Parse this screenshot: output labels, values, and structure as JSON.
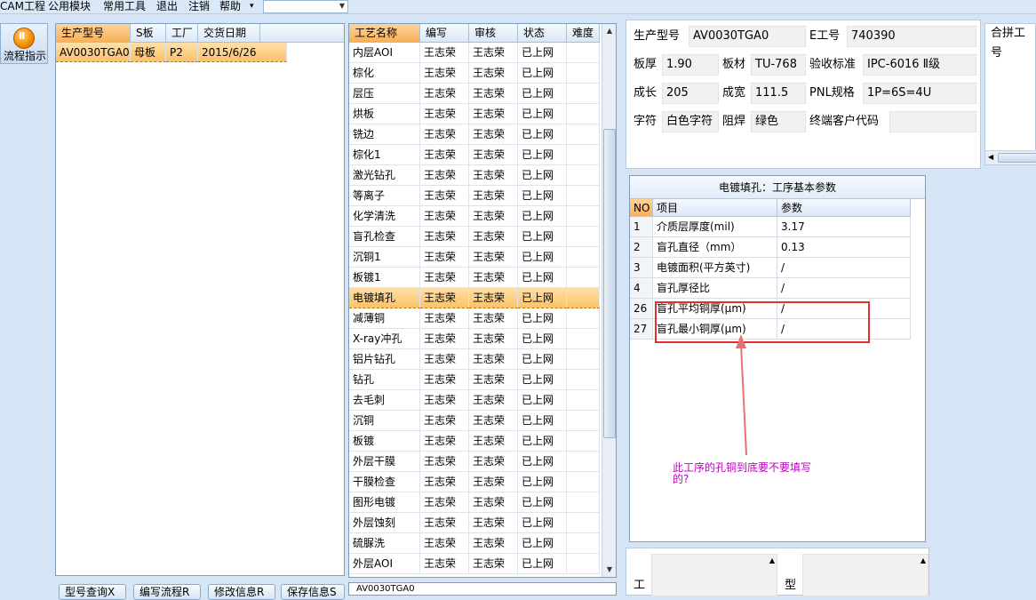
{
  "menu": {
    "items": [
      "CAM工程",
      "公用模块",
      "常用工具",
      "退出",
      "注销",
      "帮助"
    ],
    "help_arrow": "▾",
    "combo_value": ""
  },
  "toolbar": {
    "flow_label": "流程指示"
  },
  "orders": {
    "columns": [
      "生产型号",
      "S板",
      "工厂",
      "交货日期"
    ],
    "rows": [
      {
        "model": "AV0030TGA0",
        "board": "母板",
        "factory": "P2",
        "date": "2015/6/26"
      }
    ]
  },
  "processes": {
    "columns": [
      "工艺名称",
      "编写",
      "审核",
      "状态",
      "难度"
    ],
    "rows": [
      [
        "内层AOI",
        "王志荣",
        "王志荣",
        "已上网",
        ""
      ],
      [
        "棕化",
        "王志荣",
        "王志荣",
        "已上网",
        ""
      ],
      [
        "层压",
        "王志荣",
        "王志荣",
        "已上网",
        ""
      ],
      [
        "烘板",
        "王志荣",
        "王志荣",
        "已上网",
        ""
      ],
      [
        "铣边",
        "王志荣",
        "王志荣",
        "已上网",
        ""
      ],
      [
        "棕化1",
        "王志荣",
        "王志荣",
        "已上网",
        ""
      ],
      [
        "激光钻孔",
        "王志荣",
        "王志荣",
        "已上网",
        ""
      ],
      [
        "等离子",
        "王志荣",
        "王志荣",
        "已上网",
        ""
      ],
      [
        "化学清洗",
        "王志荣",
        "王志荣",
        "已上网",
        ""
      ],
      [
        "盲孔检查",
        "王志荣",
        "王志荣",
        "已上网",
        ""
      ],
      [
        "沉铜1",
        "王志荣",
        "王志荣",
        "已上网",
        ""
      ],
      [
        "板镀1",
        "王志荣",
        "王志荣",
        "已上网",
        ""
      ],
      [
        "电镀填孔",
        "王志荣",
        "王志荣",
        "已上网",
        ""
      ],
      [
        "减薄铜",
        "王志荣",
        "王志荣",
        "已上网",
        ""
      ],
      [
        "X-ray冲孔",
        "王志荣",
        "王志荣",
        "已上网",
        ""
      ],
      [
        "铝片钻孔",
        "王志荣",
        "王志荣",
        "已上网",
        ""
      ],
      [
        "钻孔",
        "王志荣",
        "王志荣",
        "已上网",
        ""
      ],
      [
        "去毛刺",
        "王志荣",
        "王志荣",
        "已上网",
        ""
      ],
      [
        "沉铜",
        "王志荣",
        "王志荣",
        "已上网",
        ""
      ],
      [
        "板镀",
        "王志荣",
        "王志荣",
        "已上网",
        ""
      ],
      [
        "外层干膜",
        "王志荣",
        "王志荣",
        "已上网",
        ""
      ],
      [
        "干膜检查",
        "王志荣",
        "王志荣",
        "已上网",
        ""
      ],
      [
        "图形电镀",
        "王志荣",
        "王志荣",
        "已上网",
        ""
      ],
      [
        "外层蚀刻",
        "王志荣",
        "王志荣",
        "已上网",
        ""
      ],
      [
        "硫脲洗",
        "王志荣",
        "王志荣",
        "已上网",
        ""
      ],
      [
        "外层AOI",
        "王志荣",
        "王志荣",
        "已上网",
        ""
      ]
    ],
    "selected_index": 12
  },
  "tree": {
    "node": "AV0030TGA0"
  },
  "info": {
    "model_label": "生产型号",
    "model_value": "AV0030TGA0",
    "eno_label": "E工号",
    "eno_value": "740390",
    "thick_label": "板厚",
    "thick_value": "1.90",
    "material_label": "板材",
    "material_value": "TU-768",
    "std_label": "验收标准",
    "std_value": "IPC-6016 Ⅱ级",
    "len_label": "成长",
    "len_value": "205",
    "wid_label": "成宽",
    "wid_value": "111.5",
    "pnl_label": "PNL规格",
    "pnl_value": "1P=6S=4U",
    "char_label": "字符",
    "char_value": "白色字符",
    "solder_label": "阻焊",
    "solder_value": "绿色",
    "customer_label": "终端客户代码",
    "customer_value": "",
    "merge_label": "合拼工号"
  },
  "params": {
    "title": "电镀填孔：工序基本参数",
    "columns": [
      "NO",
      "项目",
      "参数"
    ],
    "rows": [
      [
        "1",
        "介质层厚度(mil)",
        "3.17"
      ],
      [
        "2",
        "盲孔直径（mm）",
        "0.13"
      ],
      [
        "3",
        "电镀面积(平方英寸)",
        "/"
      ],
      [
        "4",
        "盲孔厚径比",
        "/"
      ],
      [
        "26",
        "盲孔平均铜厚(μm)",
        "/"
      ],
      [
        "27",
        "盲孔最小铜厚(μm)",
        "/"
      ]
    ]
  },
  "annotation": {
    "text": "此工序的孔铜到底要不要填写的?",
    "color": "#c000c0",
    "box_color": "#e03030"
  },
  "bottom": {
    "buttons": [
      "型号查询X",
      "编写流程R",
      "修改信息R",
      "保存信息S"
    ],
    "label_left": "工",
    "label_right": "型"
  }
}
